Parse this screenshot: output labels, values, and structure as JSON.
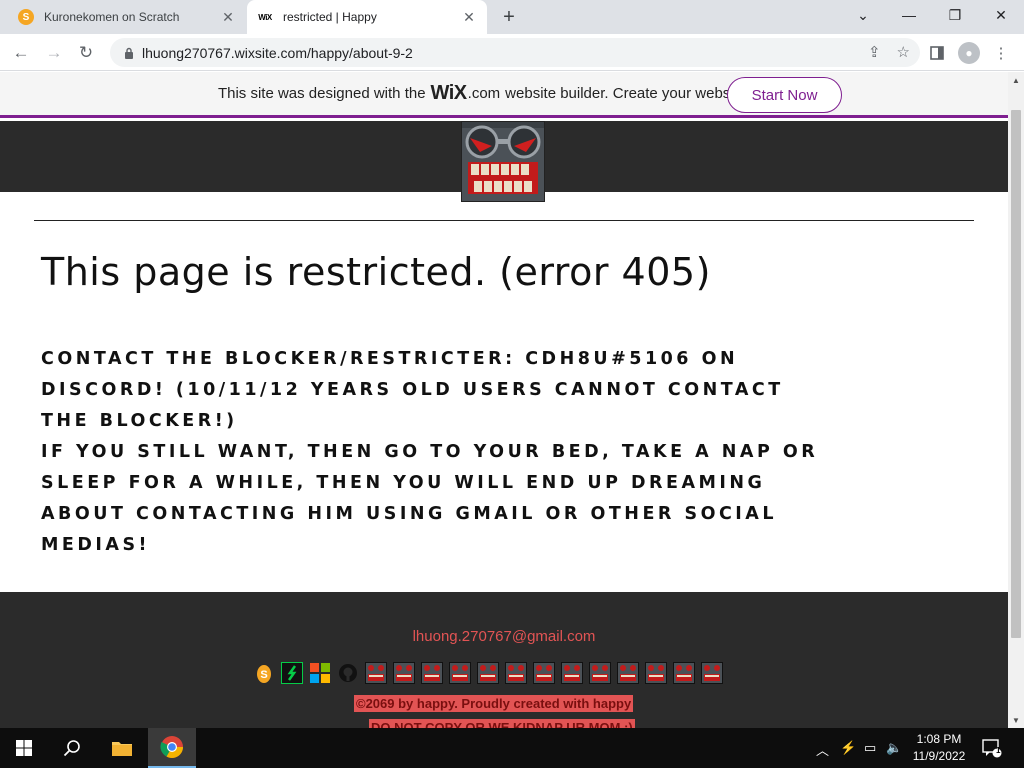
{
  "browser": {
    "tabs": [
      {
        "title": "Kuronekomen on Scratch",
        "favicon": "scratch-cat"
      },
      {
        "title": "restricted | Happy",
        "favicon": "wix"
      }
    ],
    "url": "lhuong270767.wixsite.com/happy/about-9-2"
  },
  "wix_banner": {
    "text_before": "This site was designed with the",
    "brand": "WiX",
    "brand_suffix": ".com",
    "text_after": "website builder. Create your website today.",
    "cta": "Start Now",
    "accent": "#7f1f90"
  },
  "page": {
    "heading": "This page is restricted. (error 405)",
    "message_1": "Contact the blocker/restricter: CDH8U#5106 on discord! (10/11/12 years old users cannot contact the blocker!)",
    "message_2": "if you still want, then go to your bed, take a nap or sleep for a while, then you will end up dreaming about contacting him using gmail or other social medias!"
  },
  "footer": {
    "email": "lhuong.270767@gmail.com",
    "copyright": "©2069 by happy. Proudly created with happy",
    "notice": "DO NOT COPY OR WE KIDNAP UR MOM :)",
    "accent": "#e25454",
    "social_icons": [
      "scratch-icon",
      "deviantart-icon",
      "microsoft-icon",
      "github-icon",
      "monster-icon",
      "monster-icon",
      "monster-icon",
      "monster-icon",
      "monster-icon",
      "monster-icon",
      "monster-icon",
      "monster-icon",
      "monster-icon",
      "monster-icon",
      "monster-icon",
      "monster-icon",
      "monster-icon"
    ]
  },
  "taskbar": {
    "time": "1:08 PM",
    "date": "11/9/2022",
    "notifications": "1"
  }
}
